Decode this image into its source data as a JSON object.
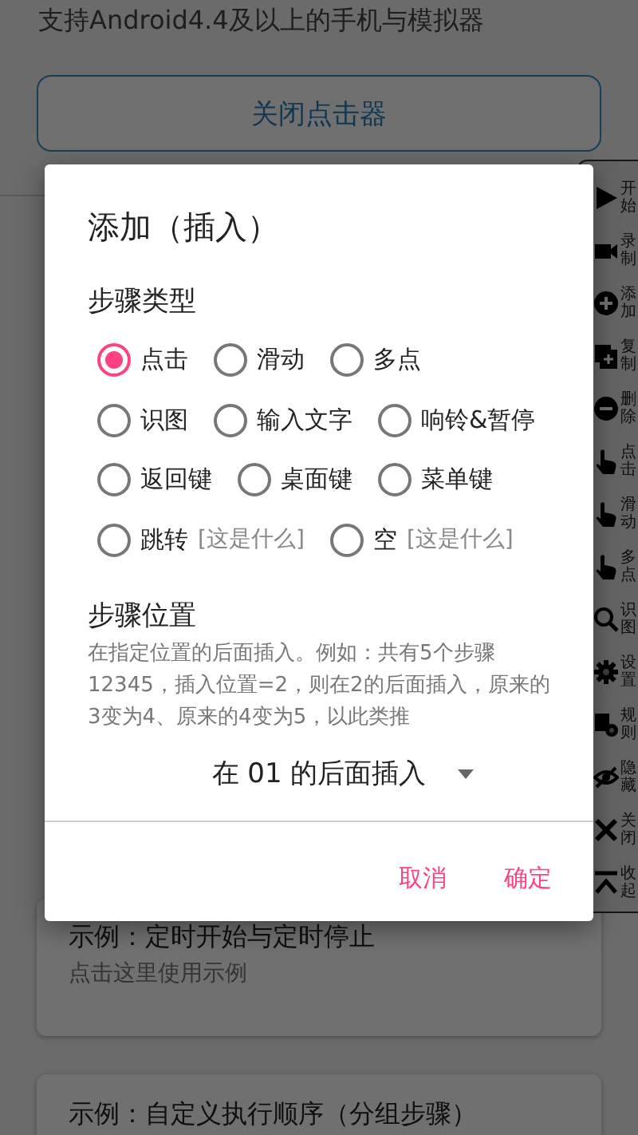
{
  "background": {
    "subtitle": "支持Android4.4及以上的手机与模拟器",
    "close_button": "关闭点击器",
    "cards": [
      {
        "title": "示例：定时开始与定时停止",
        "subtitle": "点击这里使用示例"
      },
      {
        "title": "示例：自定义执行顺序（分组步骤）"
      }
    ]
  },
  "toolbar": {
    "items": [
      {
        "kind": "play",
        "label": "开始"
      },
      {
        "kind": "record",
        "label": "录制"
      },
      {
        "kind": "add",
        "label": "添加"
      },
      {
        "kind": "copy",
        "label": "复制"
      },
      {
        "kind": "remove",
        "label": "删除"
      },
      {
        "kind": "hand",
        "label": "点击"
      },
      {
        "kind": "hand",
        "label": "滑动"
      },
      {
        "kind": "hand",
        "label": "多点"
      },
      {
        "kind": "search",
        "label": "识图"
      },
      {
        "kind": "gear",
        "label": "设置"
      },
      {
        "kind": "rules",
        "label": "规则"
      },
      {
        "kind": "hide",
        "label": "隐藏"
      },
      {
        "kind": "close",
        "label": "关闭"
      },
      {
        "kind": "collapse",
        "label": "收起"
      }
    ]
  },
  "dialog": {
    "title": "添加（插入）",
    "step_type": {
      "heading": "步骤类型",
      "rows": [
        {
          "options": [
            {
              "label": "点击",
              "selected": true
            },
            {
              "label": "滑动",
              "selected": false
            },
            {
              "label": "多点",
              "selected": false
            }
          ]
        },
        {
          "options": [
            {
              "label": "识图",
              "selected": false
            },
            {
              "label": "输入文字",
              "selected": false
            },
            {
              "label": "响铃&暂停",
              "selected": false
            }
          ]
        },
        {
          "options": [
            {
              "label": "返回键",
              "selected": false
            },
            {
              "label": "桌面键",
              "selected": false
            },
            {
              "label": "菜单键",
              "selected": false
            }
          ]
        },
        {
          "options": [
            {
              "label": "跳转",
              "hint": "[这是什么]",
              "selected": false
            },
            {
              "label": "空",
              "hint": "[这是什么]",
              "selected": false
            }
          ]
        }
      ]
    },
    "step_position": {
      "heading": "步骤位置",
      "description": "在指定位置的后面插入。例如：共有5个步骤12345，插入位置=2，则在2的后面插入，原来的3变为4、原来的4变为5，以此类推",
      "dropdown": "在 01 的后面插入"
    },
    "buttons": [
      "取消",
      "确定"
    ]
  }
}
